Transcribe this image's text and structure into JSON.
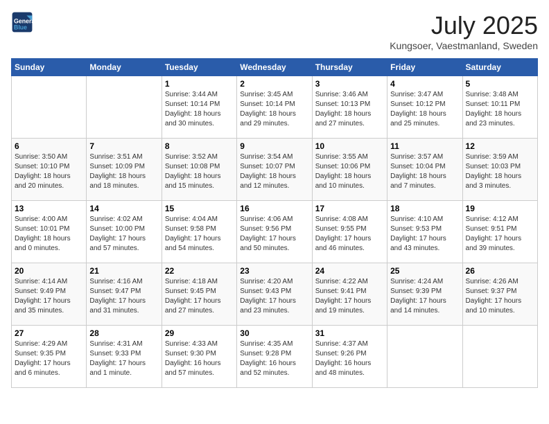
{
  "logo": {
    "line1": "General",
    "line2": "Blue"
  },
  "title": "July 2025",
  "location": "Kungsoer, Vaestmanland, Sweden",
  "weekdays": [
    "Sunday",
    "Monday",
    "Tuesday",
    "Wednesday",
    "Thursday",
    "Friday",
    "Saturday"
  ],
  "weeks": [
    [
      {
        "day": "",
        "info": ""
      },
      {
        "day": "",
        "info": ""
      },
      {
        "day": "1",
        "info": "Sunrise: 3:44 AM\nSunset: 10:14 PM\nDaylight: 18 hours and 30 minutes."
      },
      {
        "day": "2",
        "info": "Sunrise: 3:45 AM\nSunset: 10:14 PM\nDaylight: 18 hours and 29 minutes."
      },
      {
        "day": "3",
        "info": "Sunrise: 3:46 AM\nSunset: 10:13 PM\nDaylight: 18 hours and 27 minutes."
      },
      {
        "day": "4",
        "info": "Sunrise: 3:47 AM\nSunset: 10:12 PM\nDaylight: 18 hours and 25 minutes."
      },
      {
        "day": "5",
        "info": "Sunrise: 3:48 AM\nSunset: 10:11 PM\nDaylight: 18 hours and 23 minutes."
      }
    ],
    [
      {
        "day": "6",
        "info": "Sunrise: 3:50 AM\nSunset: 10:10 PM\nDaylight: 18 hours and 20 minutes."
      },
      {
        "day": "7",
        "info": "Sunrise: 3:51 AM\nSunset: 10:09 PM\nDaylight: 18 hours and 18 minutes."
      },
      {
        "day": "8",
        "info": "Sunrise: 3:52 AM\nSunset: 10:08 PM\nDaylight: 18 hours and 15 minutes."
      },
      {
        "day": "9",
        "info": "Sunrise: 3:54 AM\nSunset: 10:07 PM\nDaylight: 18 hours and 12 minutes."
      },
      {
        "day": "10",
        "info": "Sunrise: 3:55 AM\nSunset: 10:06 PM\nDaylight: 18 hours and 10 minutes."
      },
      {
        "day": "11",
        "info": "Sunrise: 3:57 AM\nSunset: 10:04 PM\nDaylight: 18 hours and 7 minutes."
      },
      {
        "day": "12",
        "info": "Sunrise: 3:59 AM\nSunset: 10:03 PM\nDaylight: 18 hours and 3 minutes."
      }
    ],
    [
      {
        "day": "13",
        "info": "Sunrise: 4:00 AM\nSunset: 10:01 PM\nDaylight: 18 hours and 0 minutes."
      },
      {
        "day": "14",
        "info": "Sunrise: 4:02 AM\nSunset: 10:00 PM\nDaylight: 17 hours and 57 minutes."
      },
      {
        "day": "15",
        "info": "Sunrise: 4:04 AM\nSunset: 9:58 PM\nDaylight: 17 hours and 54 minutes."
      },
      {
        "day": "16",
        "info": "Sunrise: 4:06 AM\nSunset: 9:56 PM\nDaylight: 17 hours and 50 minutes."
      },
      {
        "day": "17",
        "info": "Sunrise: 4:08 AM\nSunset: 9:55 PM\nDaylight: 17 hours and 46 minutes."
      },
      {
        "day": "18",
        "info": "Sunrise: 4:10 AM\nSunset: 9:53 PM\nDaylight: 17 hours and 43 minutes."
      },
      {
        "day": "19",
        "info": "Sunrise: 4:12 AM\nSunset: 9:51 PM\nDaylight: 17 hours and 39 minutes."
      }
    ],
    [
      {
        "day": "20",
        "info": "Sunrise: 4:14 AM\nSunset: 9:49 PM\nDaylight: 17 hours and 35 minutes."
      },
      {
        "day": "21",
        "info": "Sunrise: 4:16 AM\nSunset: 9:47 PM\nDaylight: 17 hours and 31 minutes."
      },
      {
        "day": "22",
        "info": "Sunrise: 4:18 AM\nSunset: 9:45 PM\nDaylight: 17 hours and 27 minutes."
      },
      {
        "day": "23",
        "info": "Sunrise: 4:20 AM\nSunset: 9:43 PM\nDaylight: 17 hours and 23 minutes."
      },
      {
        "day": "24",
        "info": "Sunrise: 4:22 AM\nSunset: 9:41 PM\nDaylight: 17 hours and 19 minutes."
      },
      {
        "day": "25",
        "info": "Sunrise: 4:24 AM\nSunset: 9:39 PM\nDaylight: 17 hours and 14 minutes."
      },
      {
        "day": "26",
        "info": "Sunrise: 4:26 AM\nSunset: 9:37 PM\nDaylight: 17 hours and 10 minutes."
      }
    ],
    [
      {
        "day": "27",
        "info": "Sunrise: 4:29 AM\nSunset: 9:35 PM\nDaylight: 17 hours and 6 minutes."
      },
      {
        "day": "28",
        "info": "Sunrise: 4:31 AM\nSunset: 9:33 PM\nDaylight: 17 hours and 1 minute."
      },
      {
        "day": "29",
        "info": "Sunrise: 4:33 AM\nSunset: 9:30 PM\nDaylight: 16 hours and 57 minutes."
      },
      {
        "day": "30",
        "info": "Sunrise: 4:35 AM\nSunset: 9:28 PM\nDaylight: 16 hours and 52 minutes."
      },
      {
        "day": "31",
        "info": "Sunrise: 4:37 AM\nSunset: 9:26 PM\nDaylight: 16 hours and 48 minutes."
      },
      {
        "day": "",
        "info": ""
      },
      {
        "day": "",
        "info": ""
      }
    ]
  ]
}
